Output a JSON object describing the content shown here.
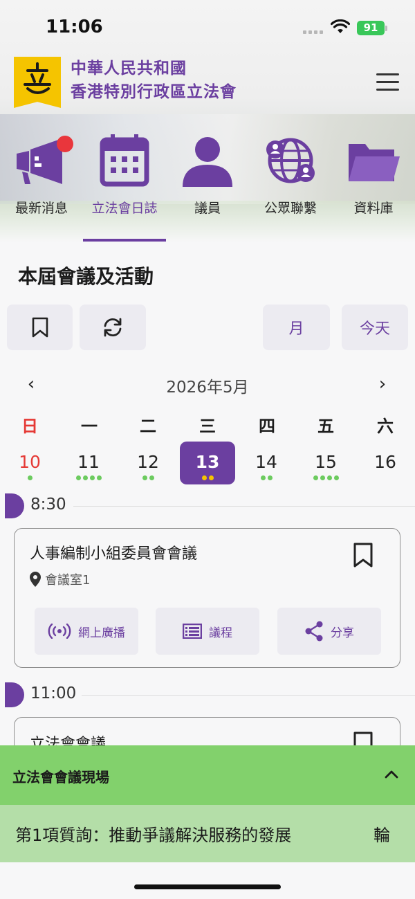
{
  "status_bar": {
    "time": "11:06",
    "battery": "91"
  },
  "header": {
    "title_line1": "中華人民共和國",
    "title_line2": "香港特別行政區立法會"
  },
  "nav": {
    "items": [
      {
        "label": "最新消息",
        "icon": "megaphone-icon",
        "has_notification": true
      },
      {
        "label": "立法會日誌",
        "icon": "calendar-icon",
        "active": true
      },
      {
        "label": "議員",
        "icon": "person-icon"
      },
      {
        "label": "公眾聯繫",
        "icon": "globe-people-icon"
      },
      {
        "label": "資料庫",
        "icon": "folder-icon"
      }
    ]
  },
  "section": {
    "title": "本屆會議及活動"
  },
  "toolbar": {
    "bookmark_icon": "bookmark-icon",
    "refresh_icon": "refresh-icon",
    "month_label": "月",
    "today_label": "今天"
  },
  "calendar": {
    "month_label": "2026年5月",
    "weekdays": [
      "日",
      "一",
      "二",
      "三",
      "四",
      "五",
      "六"
    ],
    "days": [
      {
        "num": "10",
        "dots": 1,
        "sunday": true
      },
      {
        "num": "11",
        "dots": 4
      },
      {
        "num": "12",
        "dots": 2
      },
      {
        "num": "13",
        "dots": 2,
        "selected": true
      },
      {
        "num": "14",
        "dots": 2
      },
      {
        "num": "15",
        "dots": 4
      },
      {
        "num": "16",
        "dots": 0
      }
    ],
    "colors": {
      "accent": "#6b3fa0",
      "sunday": "#e53935",
      "dot": "#6ccb5f",
      "dot_selected": "#f5c400"
    }
  },
  "events": [
    {
      "time": "8:30",
      "title": "人事編制小組委員會會議",
      "venue": "會議室1",
      "actions": {
        "broadcast": "網上廣播",
        "agenda": "議程",
        "share": "分享"
      }
    },
    {
      "time": "11:00",
      "title": "立法會會議"
    }
  ],
  "live": {
    "title": "立法會會議現場",
    "ticker": "第1項質詢：推動爭議解決服務的發展",
    "ticker_next": "輪"
  }
}
